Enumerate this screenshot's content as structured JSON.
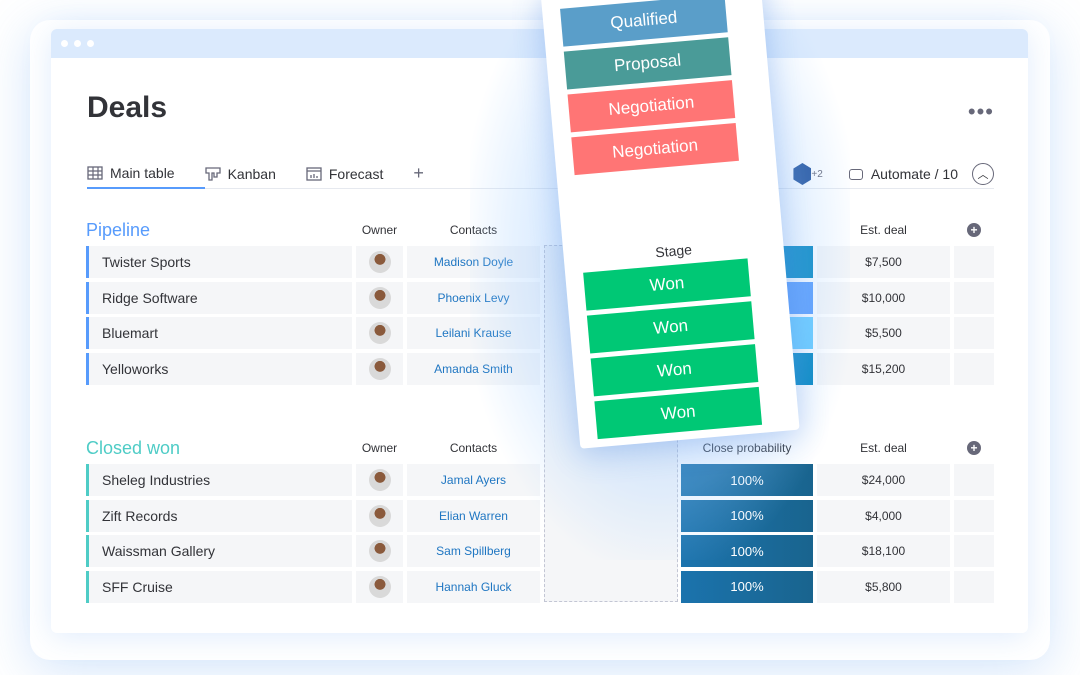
{
  "board": {
    "title": "Deals",
    "more_icon": "more-horizontal-icon"
  },
  "tabs": [
    {
      "label": "Main table",
      "icon": "table-icon"
    },
    {
      "label": "Kanban",
      "icon": "kanban-icon"
    },
    {
      "label": "Forecast",
      "icon": "chart-icon"
    }
  ],
  "add_tab": "+",
  "toolbar": {
    "avatar_count": "+2",
    "automate": "Automate / 10"
  },
  "columns": {
    "owner": "Owner",
    "contacts": "Contacts",
    "close_probability": "Close probability",
    "est_deal": "Est. deal"
  },
  "pipeline": {
    "title": "Pipeline",
    "color": "#579bfc",
    "rows": [
      {
        "name": "Twister Sports",
        "contact": "Madison Doyle",
        "prob_color": "#0086c0",
        "deal": "$7,500"
      },
      {
        "name": "Ridge Software",
        "contact": "Phoenix Levy",
        "prob_color": "#579bfc",
        "deal": "$10,000"
      },
      {
        "name": "Bluemart",
        "contact": "Leilani Krause",
        "prob_color": "#66ccff",
        "deal": "$5,500"
      },
      {
        "name": "Yelloworks",
        "contact": "Amanda Smith",
        "prob_color": "#0086c0",
        "deal": "$15,200"
      }
    ]
  },
  "closed_won": {
    "title": "Closed won",
    "color": "#4eccc6",
    "rows": [
      {
        "name": "Sheleg Industries",
        "contact": "Jamal Ayers",
        "prob": "100%",
        "deal": "$24,000"
      },
      {
        "name": "Zift Records",
        "contact": "Elian Warren",
        "prob": "100%",
        "deal": "$4,000"
      },
      {
        "name": "Waissman Gallery",
        "contact": "Sam Spillberg",
        "prob": "100%",
        "deal": "$18,100"
      },
      {
        "name": "SFF Cruise",
        "contact": "Hannah Gluck",
        "prob": "100%",
        "deal": "$5,800"
      }
    ]
  },
  "dragged_column": {
    "header": "Stage",
    "top_labels": [
      {
        "label": "Qualified",
        "color": "#5a9ec9"
      },
      {
        "label": "Proposal",
        "color": "#4a9b98"
      },
      {
        "label": "Negotiation",
        "color": "#ff7575"
      },
      {
        "label": "Negotiation",
        "color": "#ff7575"
      }
    ],
    "won_labels": [
      "Won",
      "Won",
      "Won",
      "Won"
    ],
    "won_color": "#00c875"
  }
}
